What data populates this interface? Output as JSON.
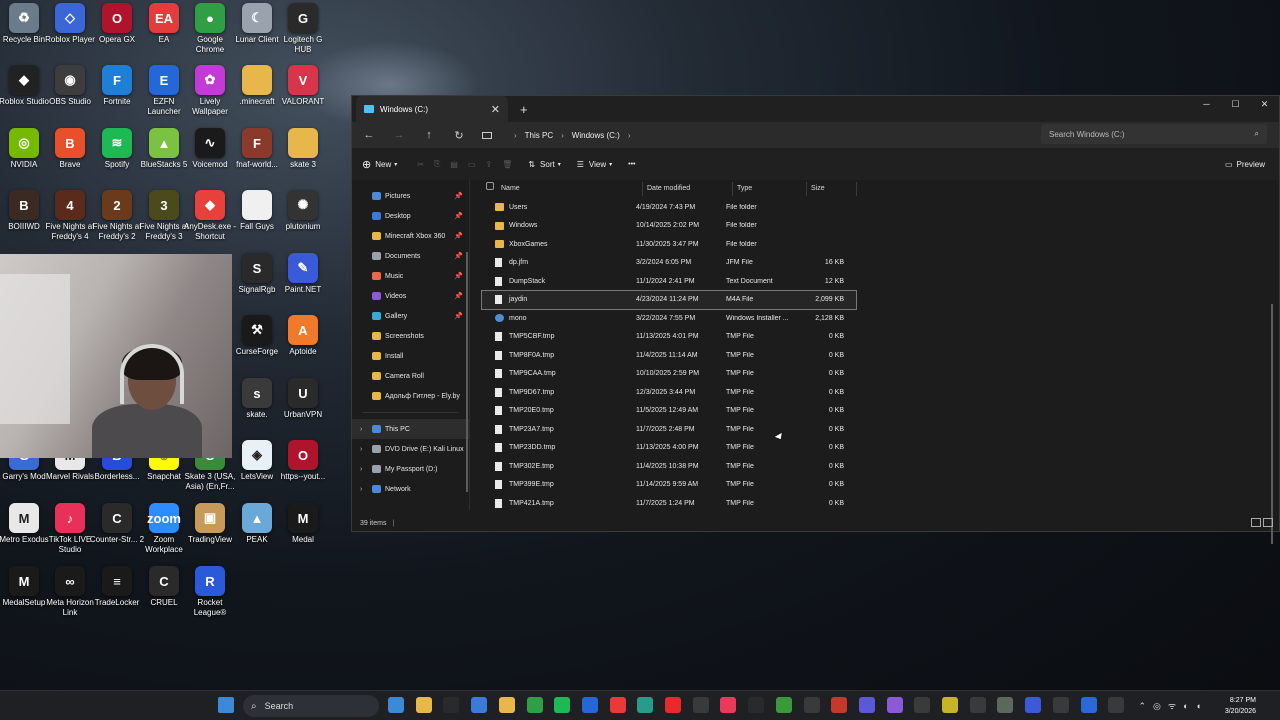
{
  "desktop": {
    "icons": [
      {
        "label": "Recycle Bin",
        "color": "#6a7b8c",
        "glyph": "♻"
      },
      {
        "label": "Roblox Player",
        "color": "#3a66d8",
        "glyph": "◇"
      },
      {
        "label": "Opera GX",
        "color": "#b0142c",
        "glyph": "O"
      },
      {
        "label": "EA",
        "color": "#e23c3c",
        "glyph": "EA"
      },
      {
        "label": "Google Chrome",
        "color": "#2f9e44",
        "glyph": "●"
      },
      {
        "label": "Lunar Client",
        "color": "#9aa3ad",
        "glyph": "☾"
      },
      {
        "label": "Logitech G HUB",
        "color": "#2a2a2a",
        "glyph": "G"
      },
      {
        "label": "Roblox Studio",
        "color": "#222",
        "glyph": "◆"
      },
      {
        "label": "OBS Studio",
        "color": "#3d3d3d",
        "glyph": "◉"
      },
      {
        "label": "Fortnite",
        "color": "#1e7fd8",
        "glyph": "F"
      },
      {
        "label": "EZFN Launcher",
        "color": "#2468d8",
        "glyph": "E"
      },
      {
        "label": "Lively Wallpaper",
        "color": "#c43ad8",
        "glyph": "✿"
      },
      {
        "label": ".minecraft",
        "color": "#e8b74b",
        "glyph": ""
      },
      {
        "label": "VALORANT",
        "color": "#d8344a",
        "glyph": "V"
      },
      {
        "label": "NVIDIA",
        "color": "#76b900",
        "glyph": "◎"
      },
      {
        "label": "Brave",
        "color": "#e8502a",
        "glyph": "B"
      },
      {
        "label": "Spotify",
        "color": "#1db954",
        "glyph": "≋"
      },
      {
        "label": "BlueStacks 5",
        "color": "#7cc242",
        "glyph": "▲"
      },
      {
        "label": "Voicemod",
        "color": "#1a1a1a",
        "glyph": "∿"
      },
      {
        "label": "fnaf-world...",
        "color": "#8a3a2a",
        "glyph": "F"
      },
      {
        "label": "skate 3",
        "color": "#e8b74b",
        "glyph": ""
      },
      {
        "label": "BOIIIWD",
        "color": "#3a2a22",
        "glyph": "B"
      },
      {
        "label": "Five Nights at Freddy's 4",
        "color": "#5a2a1a",
        "glyph": "4"
      },
      {
        "label": "Five Nights at Freddy's 2",
        "color": "#6a3a1a",
        "glyph": "2"
      },
      {
        "label": "Five Nights at Freddy's 3",
        "color": "#4a4a1a",
        "glyph": "3"
      },
      {
        "label": "AnyDesk.exe - Shortcut",
        "color": "#e8403a",
        "glyph": "◆"
      },
      {
        "label": "Fall Guys",
        "color": "#f0f0f0",
        "glyph": ""
      },
      {
        "label": "plutonium",
        "color": "#333",
        "glyph": "✺"
      },
      {
        "label": "SignalRgb",
        "color": "#2a2a2a",
        "glyph": "S"
      },
      {
        "label": "Paint.NET",
        "color": "#3a5ad8",
        "glyph": "✎"
      },
      {
        "label": "CurseForge",
        "color": "#1a1a1a",
        "glyph": "⚒"
      },
      {
        "label": "Aptoide",
        "color": "#f07a2a",
        "glyph": "A"
      },
      {
        "label": "skate.",
        "color": "#3a3a3a",
        "glyph": "s"
      },
      {
        "label": "UrbanVPN",
        "color": "#2a2a2a",
        "glyph": "U"
      },
      {
        "label": "Garry's Mod",
        "color": "#3a6ad8",
        "glyph": "G"
      },
      {
        "label": "Marvel Rivals",
        "color": "#e8e8e8",
        "glyph": "M"
      },
      {
        "label": "Borderless...",
        "color": "#2a4ad8",
        "glyph": "B"
      },
      {
        "label": "Snapchat",
        "color": "#fffc00",
        "glyph": "☺"
      },
      {
        "label": "Skate 3 (USA, Asia) (En,Fr...",
        "color": "#3a8a3a",
        "glyph": "S"
      },
      {
        "label": "LetsView",
        "color": "#e8f0f8",
        "glyph": "◈"
      },
      {
        "label": "https--yout...",
        "color": "#b0142c",
        "glyph": "O"
      },
      {
        "label": "Metro Exodus",
        "color": "#e8e8e8",
        "glyph": "M"
      },
      {
        "label": "TikTok LIVE Studio",
        "color": "#e8305a",
        "glyph": "♪"
      },
      {
        "label": "Counter-Str... 2",
        "color": "#2a2a2a",
        "glyph": "C"
      },
      {
        "label": "Zoom Workplace",
        "color": "#2d8cff",
        "glyph": "zoom"
      },
      {
        "label": "TradingView",
        "color": "#c89a5a",
        "glyph": "▣"
      },
      {
        "label": "PEAK",
        "color": "#6aa8d8",
        "glyph": "▲"
      },
      {
        "label": "Medal",
        "color": "#1a1a1a",
        "glyph": "M"
      },
      {
        "label": "MedalSetup",
        "color": "#1a1a1a",
        "glyph": "M"
      },
      {
        "label": "Meta Horizon Link",
        "color": "#1a1a1a",
        "glyph": "∞"
      },
      {
        "label": "TradeLocker",
        "color": "#1a1a1a",
        "glyph": "≡"
      },
      {
        "label": "CRUEL",
        "color": "#2a2a2a",
        "glyph": "C"
      },
      {
        "label": "Rocket League®",
        "color": "#2a5ad8",
        "glyph": "R"
      }
    ]
  },
  "explorer": {
    "tab_title": "Windows (C:)",
    "close_tab": "✕",
    "new_tab": "+",
    "window_controls": {
      "minimize": "─",
      "maximize": "☐",
      "close": "✕"
    },
    "breadcrumb": [
      "This PC",
      "Windows (C:)"
    ],
    "search_placeholder": "Search Windows (C:)",
    "toolbar": {
      "new": "New",
      "sort": "Sort",
      "view": "View",
      "more": "•••",
      "preview": "Preview"
    },
    "sidebar": [
      {
        "label": "Pictures",
        "color": "#4a8ad8",
        "pinned": true
      },
      {
        "label": "Desktop",
        "color": "#3a7ad8",
        "pinned": true
      },
      {
        "label": "Minecraft Xbox 360",
        "color": "#e8b74b",
        "pinned": true
      },
      {
        "label": "Documents",
        "color": "#9aa3ad",
        "pinned": true
      },
      {
        "label": "Music",
        "color": "#e86a4a",
        "pinned": true
      },
      {
        "label": "Videos",
        "color": "#8a5ad8",
        "pinned": true
      },
      {
        "label": "Gallery",
        "color": "#3aa8d8",
        "pinned": true
      },
      {
        "label": "Screenshots",
        "color": "#e8b74b",
        "pinned": false
      },
      {
        "label": "Install",
        "color": "#e8b74b",
        "pinned": false
      },
      {
        "label": "Camera Roll",
        "color": "#e8b74b",
        "pinned": false
      },
      {
        "label": "Адольф Гитлер - Ely.by",
        "color": "#e8b74b",
        "pinned": false
      }
    ],
    "sidebar_drives": [
      {
        "label": "This PC",
        "color": "#4a8ad8",
        "selected": true
      },
      {
        "label": "DVD Drive (E:) Kali Linux",
        "color": "#9aa3ad",
        "selected": false
      },
      {
        "label": "My Passport (D:)",
        "color": "#9aa3ad",
        "selected": false
      },
      {
        "label": "Network",
        "color": "#4a8ad8",
        "selected": false
      }
    ],
    "columns": {
      "name": "Name",
      "date": "Date modified",
      "type": "Type",
      "size": "Size"
    },
    "files": [
      {
        "name": "Users",
        "date": "4/19/2024 7:43 PM",
        "type": "File folder",
        "size": "",
        "kind": "folder"
      },
      {
        "name": "Windows",
        "date": "10/14/2025 2:02 PM",
        "type": "File folder",
        "size": "",
        "kind": "folder"
      },
      {
        "name": "XboxGames",
        "date": "11/30/2025 3:47 PM",
        "type": "File folder",
        "size": "",
        "kind": "folder"
      },
      {
        "name": "dp.jfm",
        "date": "3/2/2024 6:05 PM",
        "type": "JFM File",
        "size": "16 KB",
        "kind": "file"
      },
      {
        "name": "DumpStack",
        "date": "11/1/2024 2:41 PM",
        "type": "Text Document",
        "size": "12 KB",
        "kind": "file"
      },
      {
        "name": "jaydin",
        "date": "4/23/2024 11:24 PM",
        "type": "M4A File",
        "size": "2,099 KB",
        "kind": "file"
      },
      {
        "name": "mono",
        "date": "3/22/2024 7:55 PM",
        "type": "Windows Installer ...",
        "size": "2,128 KB",
        "kind": "msi"
      },
      {
        "name": "TMP5CBF.tmp",
        "date": "11/13/2025 4:01 PM",
        "type": "TMP File",
        "size": "0 KB",
        "kind": "file"
      },
      {
        "name": "TMP8F0A.tmp",
        "date": "11/4/2025 11:14 AM",
        "type": "TMP File",
        "size": "0 KB",
        "kind": "file"
      },
      {
        "name": "TMP9CAA.tmp",
        "date": "10/10/2025 2:59 PM",
        "type": "TMP File",
        "size": "0 KB",
        "kind": "file"
      },
      {
        "name": "TMP9D67.tmp",
        "date": "12/3/2025 3:44 PM",
        "type": "TMP File",
        "size": "0 KB",
        "kind": "file"
      },
      {
        "name": "TMP20E0.tmp",
        "date": "11/5/2025 12:49 AM",
        "type": "TMP File",
        "size": "0 KB",
        "kind": "file"
      },
      {
        "name": "TMP23A7.tmp",
        "date": "11/7/2025 2:48 PM",
        "type": "TMP File",
        "size": "0 KB",
        "kind": "file"
      },
      {
        "name": "TMP23DD.tmp",
        "date": "11/13/2025 4:00 PM",
        "type": "TMP File",
        "size": "0 KB",
        "kind": "file"
      },
      {
        "name": "TMP302E.tmp",
        "date": "11/4/2025 10:38 PM",
        "type": "TMP File",
        "size": "0 KB",
        "kind": "file"
      },
      {
        "name": "TMP399E.tmp",
        "date": "11/14/2025 9:59 AM",
        "type": "TMP File",
        "size": "0 KB",
        "kind": "file"
      },
      {
        "name": "TMP421A.tmp",
        "date": "11/7/2025 1:24 PM",
        "type": "TMP File",
        "size": "0 KB",
        "kind": "file"
      }
    ],
    "selected_file": "jaydin",
    "status": "39 items"
  },
  "taskbar": {
    "search_label": "Search",
    "time": "8:27 PM",
    "date": "3/20/2026",
    "apps": [
      "#3a8ad8",
      "#e8b74b",
      "#2a2a2a",
      "#3a7ad8",
      "#e8b74b",
      "#2f9e44",
      "#1db954",
      "#2468d8",
      "#e83a3a",
      "#2a9a8a",
      "#e82a2a",
      "#3a3a3a",
      "#e83a5a",
      "#2a2a2a",
      "#3a9a3a",
      "#3a3a3a",
      "#c43a2a",
      "#5a5ad8",
      "#8a5ad8",
      "#3a3a3a",
      "#c8b42a",
      "#3a3a3a",
      "#5a6a5a",
      "#3a5ad8",
      "#3a3a3a",
      "#2a6ad8",
      "#3a3a3a"
    ]
  }
}
